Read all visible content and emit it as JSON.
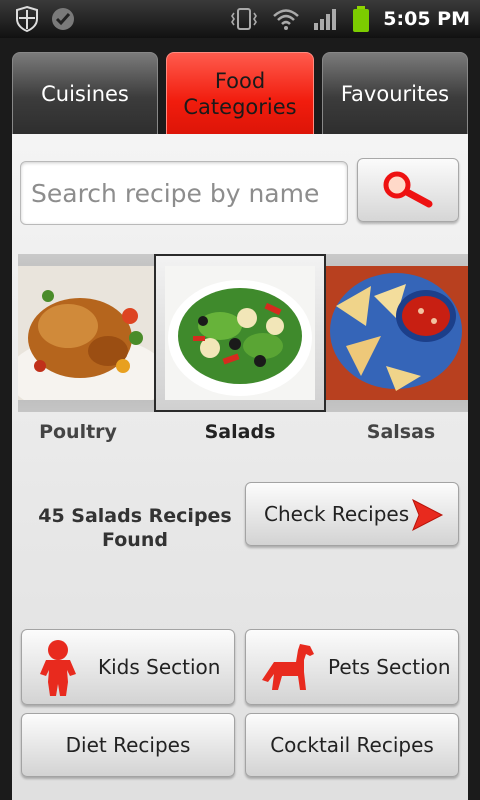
{
  "status_bar": {
    "time": "5:05 PM",
    "icons": [
      "shield-icon",
      "check-circle-icon",
      "vibrate-icon",
      "wifi-icon",
      "signal-icon",
      "battery-icon"
    ]
  },
  "tabs": [
    {
      "label": "Cuisines",
      "active": false
    },
    {
      "label": "Food\nCategories",
      "active": true
    },
    {
      "label": "Favourites",
      "active": false
    }
  ],
  "search": {
    "placeholder": "Search recipe by name",
    "value": "",
    "button_icon": "magnifier-icon"
  },
  "categories": [
    {
      "label": "Poultry",
      "selected": false
    },
    {
      "label": "Salads",
      "selected": true
    },
    {
      "label": "Salsas",
      "selected": false
    }
  ],
  "results": {
    "found_text": "45 Salads Recipes Found",
    "check_label": "Check Recipes"
  },
  "sections": {
    "kids": "Kids Section",
    "pets": "Pets Section",
    "diet": "Diet Recipes",
    "cocktail": "Cocktail Recipes"
  },
  "colors": {
    "active_tab": "#f11c0d",
    "accent_red": "#e82a1e"
  }
}
